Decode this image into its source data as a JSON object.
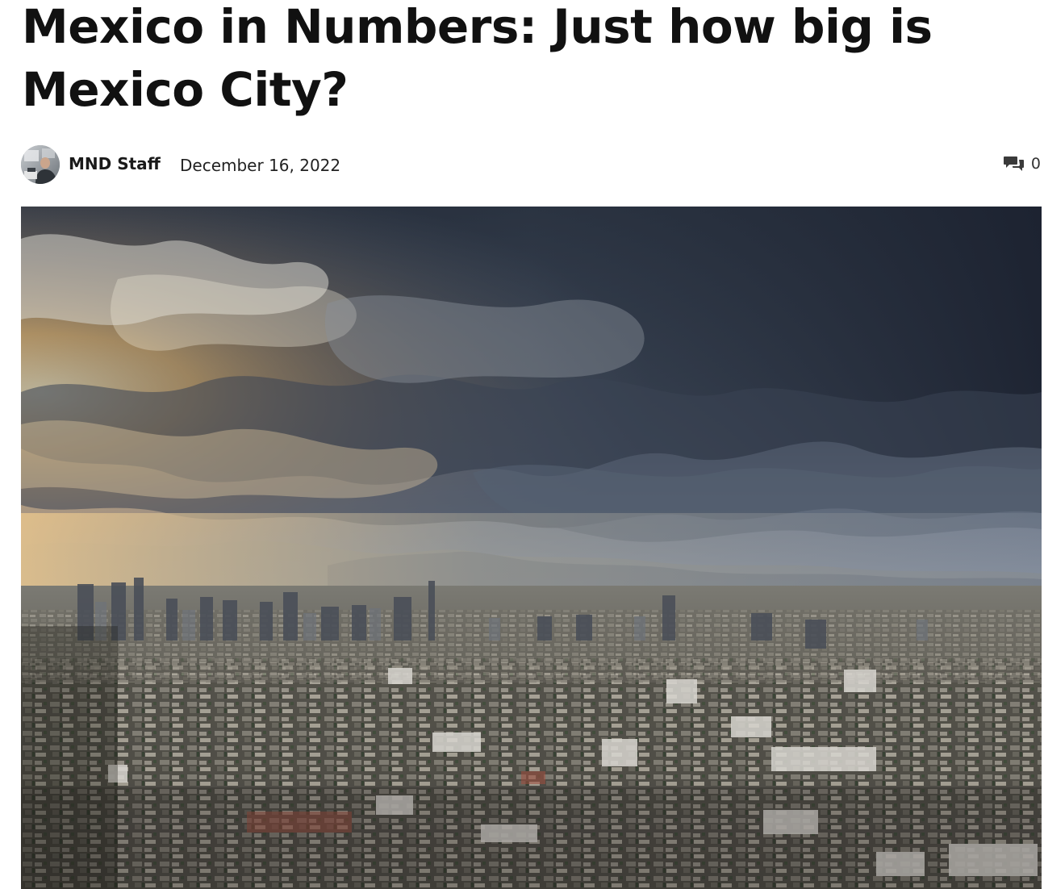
{
  "article": {
    "title": "Mexico in Numbers: Just how big is Mexico City?"
  },
  "meta": {
    "author": "MND Staff",
    "date": "December 16, 2022",
    "comment_count": "0",
    "avatar_icon": "author-avatar",
    "comment_icon": "comment-bubbles-icon"
  },
  "hero": {
    "icon": "mexico-city-skyline-photo"
  },
  "colors": {
    "text": "#111111",
    "sky_warm": "#f4c57d",
    "sky_storm": "#2b3442"
  }
}
